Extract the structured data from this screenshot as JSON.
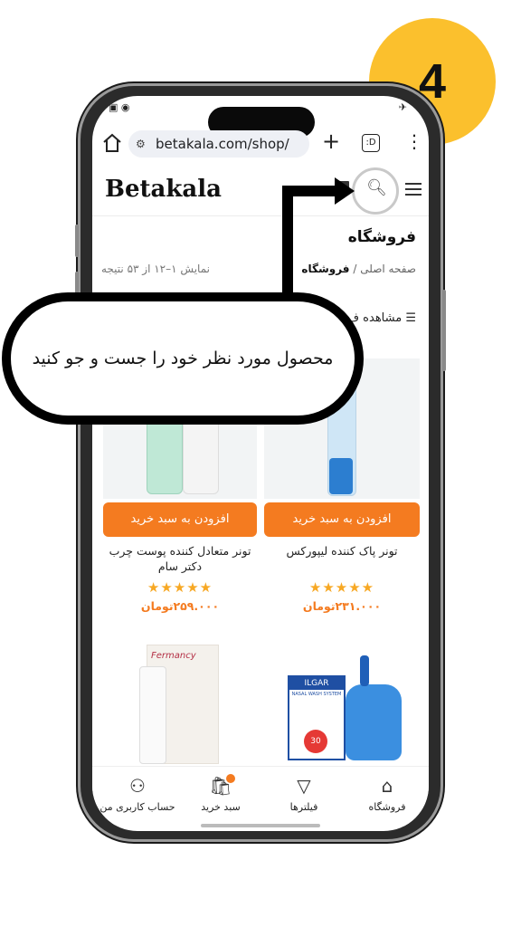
{
  "browser": {
    "url": "betakala.com/shop/",
    "tabs_count": ":D"
  },
  "site": {
    "logo": "Betakala"
  },
  "page": {
    "title": "فروشگاه",
    "breadcrumb_home": "صفحه اصلی",
    "breadcrumb_separator": "/",
    "breadcrumb_current": "فروشگاه",
    "results_text": "نمایش ۱–۱۲ از ۵۳ نتیجه",
    "view_label": "مشاهده ف"
  },
  "products": [
    {
      "name": "تونر پاک کننده لیپورکس",
      "add_label": "افزودن به سبد خرید",
      "stars": "★★★★★",
      "rating": 5,
      "price": "۲۳۱.۰۰۰تومان"
    },
    {
      "name": "تونر متعادل کننده پوست چرب دکتر سام",
      "add_label": "افزودن به سبد خرید",
      "stars": "★★★★★",
      "rating": 5,
      "price": "۲۵۹.۰۰۰تومان"
    },
    {
      "brand_label": "ILGAR",
      "brand_sublabel": "NASAL WASH SYSTEM",
      "badge_number": "30"
    },
    {
      "brand_label": "Fermancy"
    }
  ],
  "bottom_nav": [
    {
      "label": "فروشگاه",
      "icon": "shop-icon"
    },
    {
      "label": "فیلترها",
      "icon": "filter-icon"
    },
    {
      "label": "سبد خرید",
      "icon": "cart-icon",
      "badge": "0"
    },
    {
      "label": "حساب کاربری من",
      "icon": "user-icon"
    }
  ],
  "overlay": {
    "instruction": "محصول مورد نظر خود را جست و جو کنید",
    "step_number": "4"
  },
  "colors": {
    "accent": "#f47b20",
    "badge": "#fbc02d"
  }
}
